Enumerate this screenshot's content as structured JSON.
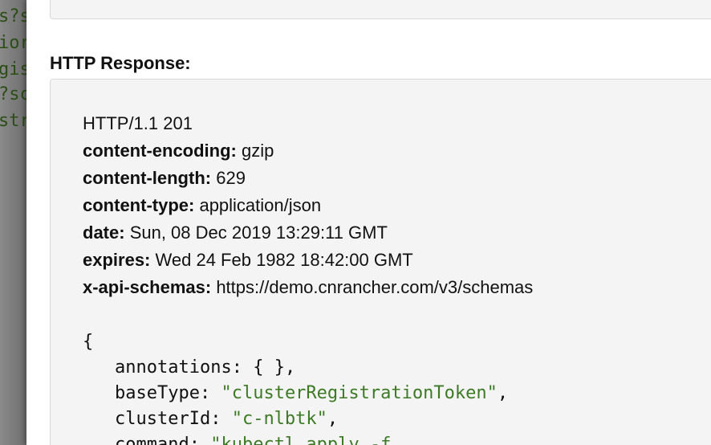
{
  "backdrop": {
    "lines": [
      "s?s",
      "ior",
      "gis",
      "?sc",
      "str"
    ]
  },
  "response": {
    "title": "HTTP Response:",
    "status_line": "HTTP/1.1 201",
    "headers": [
      {
        "name": "content-encoding:",
        "value": "gzip"
      },
      {
        "name": "content-length:",
        "value": "629"
      },
      {
        "name": "content-type:",
        "value": "application/json"
      },
      {
        "name": "date:",
        "value": "Sun, 08 Dec 2019 13:29:11 GMT"
      },
      {
        "name": "expires:",
        "value": "Wed 24 Feb 1982 18:42:00 GMT"
      },
      {
        "name": "x-api-schemas:",
        "value": "https://demo.cnrancher.com/v3/schemas"
      }
    ],
    "body": {
      "open_brace": "{",
      "fields": [
        {
          "key": "annotations:",
          "value": "{ },",
          "is_string": false
        },
        {
          "key": "baseType:",
          "value": "\"clusterRegistrationToken\"",
          "trailing": ",",
          "is_string": true
        },
        {
          "key": "clusterId:",
          "value": "\"c-nlbtk\"",
          "trailing": ",",
          "is_string": true
        },
        {
          "key": "command:",
          "value": "\"kubectl apply -f",
          "trailing": "",
          "is_string": true
        }
      ]
    }
  },
  "colors": {
    "string_value": "#3d7a25",
    "panel_bg": "#f4f4f4",
    "backdrop_text": "#2b4d16"
  }
}
